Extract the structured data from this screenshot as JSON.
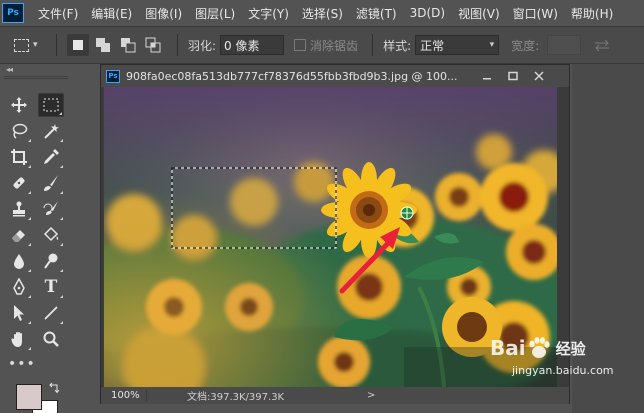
{
  "app": {
    "logo": "Ps"
  },
  "menu": [
    "文件(F)",
    "编辑(E)",
    "图像(I)",
    "图层(L)",
    "文字(Y)",
    "选择(S)",
    "滤镜(T)",
    "3D(D)",
    "视图(V)",
    "窗口(W)",
    "帮助(H)"
  ],
  "options": {
    "feather_label": "羽化:",
    "feather_value": "0 像素",
    "antialias_label": "消除锯齿",
    "style_label": "样式:",
    "style_value": "正常",
    "width_label": "宽度:"
  },
  "document": {
    "title": "908fa0ec08fa513db777cf78376d55fbb3fbd9b3.jpg @ 100...",
    "zoom": "100%",
    "info": "文档:397.3K/397.3K",
    "status_arrow": ">"
  },
  "watermark": {
    "logo": "Bai",
    "name": "经验",
    "url": "jingyan.baidu.com"
  },
  "colors": {
    "ui_dark": "#535353",
    "foreground": "#d8c9cb",
    "background": "#ffffff",
    "accent": "#31a8ff",
    "annotation_arrow": "#e8203a"
  }
}
